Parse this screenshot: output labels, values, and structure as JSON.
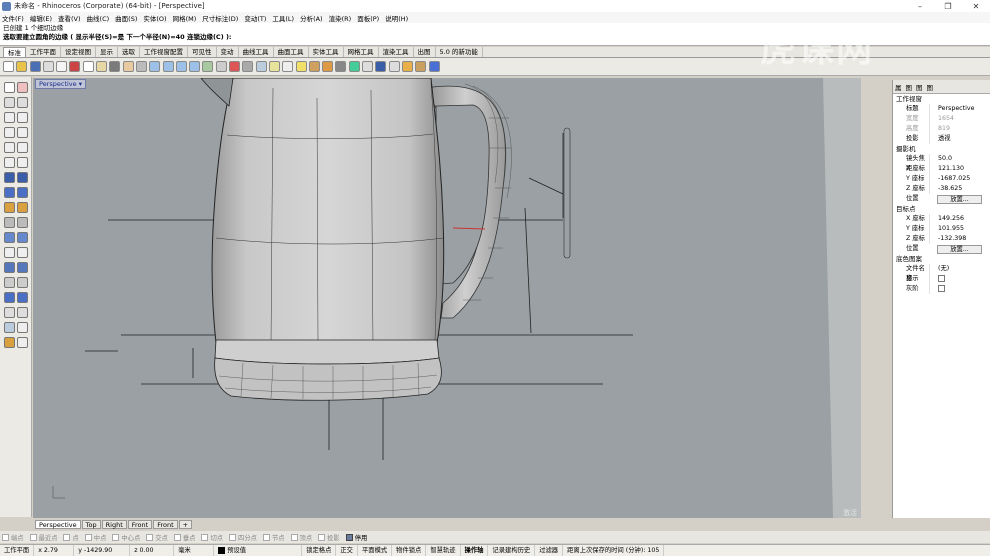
{
  "window": {
    "title": "未命名 - Rhinoceros (Corporate) (64-bit) - [Perspective]",
    "controls": [
      "–",
      "❐",
      "✕"
    ]
  },
  "menu": [
    "文件(F)",
    "编辑(E)",
    "查看(V)",
    "曲线(C)",
    "曲面(S)",
    "实体(O)",
    "网格(M)",
    "尺寸标注(D)",
    "变动(T)",
    "工具(L)",
    "分析(A)",
    "渲染(R)",
    "面板(P)",
    "说明(H)"
  ],
  "command_history": {
    "line1": "已创建 1 个细切边缘",
    "line2": "选取要建立圆角的边缘 ( 显示半径(S)=是  下一个半径(N)=40  连锁边缘(C) ):"
  },
  "toolbar_tabs": [
    "标准",
    "工作平面",
    "设定视图",
    "显示",
    "选取",
    "工作视窗配置",
    "可见性",
    "变动",
    "曲线工具",
    "曲面工具",
    "实体工具",
    "网格工具",
    "渲染工具",
    "出图",
    "5.0 的新功能"
  ],
  "viewport": {
    "label": "Perspective",
    "dropdown_icon": "chevron-down-icon",
    "background": "#9aa0a3"
  },
  "properties_panel": {
    "tabs": [
      "属",
      "图",
      "图",
      "图"
    ],
    "sections": {
      "viewport": {
        "heading": "工作视窗",
        "title_label": "标题",
        "title_value": "Perspective",
        "width_label": "宽度",
        "width_value": "1654",
        "height_label": "高度",
        "height_value": "819",
        "projection_label": "投影",
        "projection_value": "透视"
      },
      "camera": {
        "heading": "摄影机",
        "lens_label": "镜头焦距",
        "lens_value": "50.0",
        "x_label": "X 座标",
        "x_value": "121.130",
        "y_label": "Y 座标",
        "y_value": "-1687.025",
        "z_label": "Z 座标",
        "z_value": "-38.625",
        "pos_label": "位置",
        "pos_button": "放置..."
      },
      "target": {
        "heading": "目标点",
        "x_label": "X 座标",
        "x_value": "149.256",
        "y_label": "Y 座标",
        "y_value": "101.955",
        "z_label": "Z 座标",
        "z_value": "-132.398",
        "pos_label": "位置",
        "pos_button": "放置..."
      },
      "background": {
        "heading": "底色图案",
        "file_label": "文件名称",
        "file_value": "(无)",
        "show_label": "显示",
        "gray_label": "灰阶"
      }
    }
  },
  "viewport_tabs": [
    "Perspective",
    "Top",
    "Right",
    "Front",
    "Front",
    "+"
  ],
  "osnap": [
    {
      "label": "端点",
      "on": false
    },
    {
      "label": "最近点",
      "on": false
    },
    {
      "label": "点",
      "on": false
    },
    {
      "label": "中点",
      "on": false
    },
    {
      "label": "中心点",
      "on": false
    },
    {
      "label": "交点",
      "on": false
    },
    {
      "label": "垂点",
      "on": false
    },
    {
      "label": "切点",
      "on": false
    },
    {
      "label": "四分点",
      "on": false
    },
    {
      "label": "节点",
      "on": false
    },
    {
      "label": "顶点",
      "on": false
    },
    {
      "label": "投影",
      "on": false
    },
    {
      "label": "停用",
      "on": true
    }
  ],
  "status": {
    "cplane": "工作平面",
    "x": "x 2.79",
    "y": "y -1429.90",
    "z": "z 0.00",
    "unit": "毫米",
    "layer": "预设值",
    "snap": "锁定格点",
    "ortho": "正交",
    "planar": "平面模式",
    "osnap": "物件锁点",
    "smarttrack": "智慧轨迹",
    "gumball": "操作轴",
    "history": "记录建构历史",
    "filter": "过滤器",
    "autosave": "距离上次保存的时间 (分钟): 105"
  },
  "watermark": {
    "text": "虎课网",
    "activation": "激活 Windows"
  }
}
